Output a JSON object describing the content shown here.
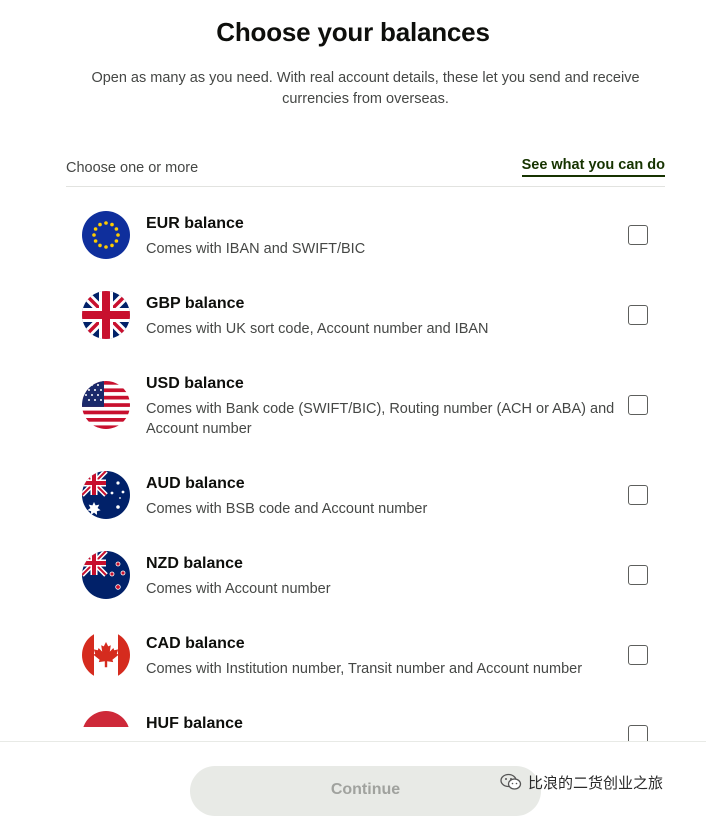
{
  "header": {
    "title": "Choose your balances",
    "subtitle": "Open as many as you need. With real account details, these let you send and receive currencies from overseas."
  },
  "subheader": {
    "label": "Choose one or more",
    "link": "See what you can do"
  },
  "balances": [
    {
      "name": "EUR balance",
      "description": "Comes with IBAN and SWIFT/BIC",
      "flag": "eu-flag-icon",
      "checked": false
    },
    {
      "name": "GBP balance",
      "description": "Comes with UK sort code, Account number and IBAN",
      "flag": "uk-flag-icon",
      "checked": false
    },
    {
      "name": "USD balance",
      "description": "Comes with Bank code (SWIFT/BIC), Routing number (ACH or ABA) and Account number",
      "flag": "us-flag-icon",
      "checked": false
    },
    {
      "name": "AUD balance",
      "description": "Comes with BSB code and Account number",
      "flag": "au-flag-icon",
      "checked": false
    },
    {
      "name": "NZD balance",
      "description": "Comes with Account number",
      "flag": "nz-flag-icon",
      "checked": false
    },
    {
      "name": "CAD balance",
      "description": "Comes with Institution number, Transit number and Account number",
      "flag": "ca-flag-icon",
      "checked": false
    },
    {
      "name": "HUF balance",
      "description": "",
      "flag": "hu-flag-icon",
      "checked": false
    }
  ],
  "footer": {
    "continue_label": "Continue"
  },
  "watermark": {
    "text": "比浪的二货创业之旅",
    "icon": "wechat-icon"
  },
  "colors": {
    "text_primary": "#0e0f0c",
    "text_secondary": "#454745",
    "link": "#163300",
    "button_disabled_bg": "#e8eae6",
    "button_disabled_text": "#a0a29e"
  }
}
